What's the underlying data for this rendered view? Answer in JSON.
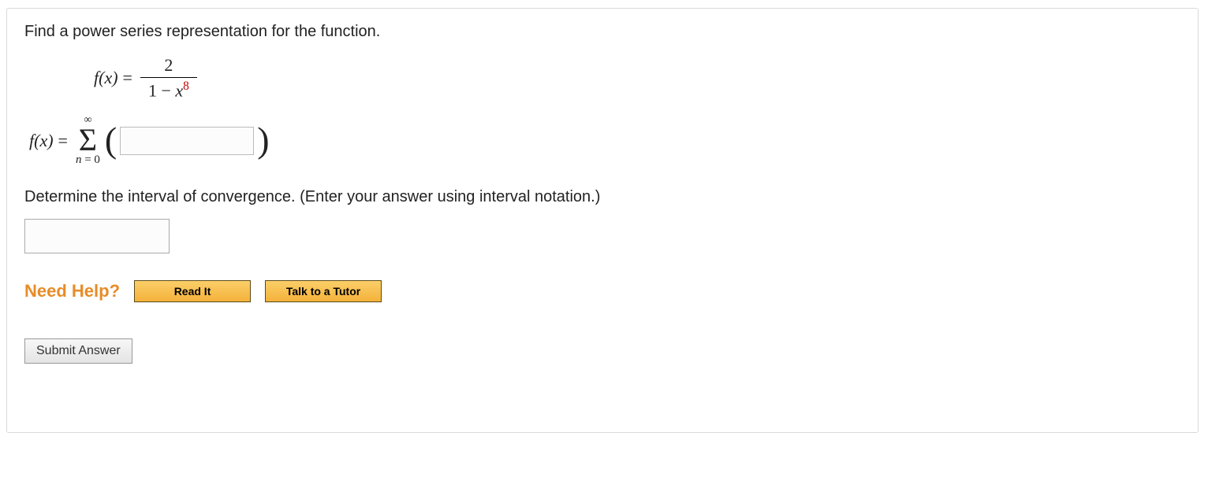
{
  "question": {
    "prompt": "Find a power series representation for the function.",
    "function": {
      "lhs": "f(x)",
      "eq": " = ",
      "numerator": "2",
      "den_left": "1 − ",
      "den_var": "x",
      "den_exp": "8"
    },
    "series": {
      "lhs": "f(x)",
      "eq": " = ",
      "sum_top": "∞",
      "sum_bottom_var": "n",
      "sum_bottom_eq": " = 0",
      "lparen": "(",
      "rparen": ")",
      "input_value": ""
    },
    "interval_prompt": "Determine the interval of convergence. (Enter your answer using interval notation.)",
    "interval_value": ""
  },
  "help": {
    "label": "Need Help?",
    "read": "Read It",
    "tutor": "Talk to a Tutor"
  },
  "submit": "Submit Answer"
}
